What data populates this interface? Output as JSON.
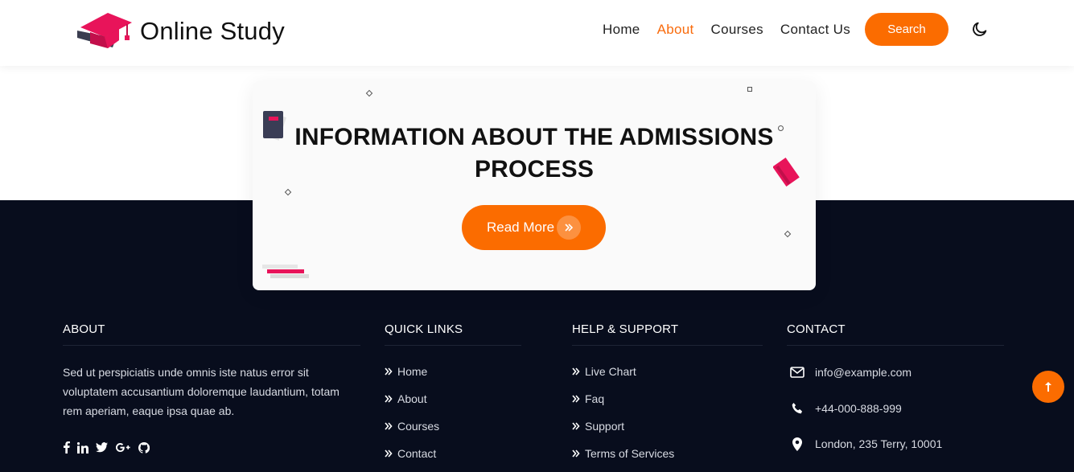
{
  "header": {
    "brand": "Online Study",
    "nav": [
      {
        "label": "Home",
        "active": false
      },
      {
        "label": "About",
        "active": true
      },
      {
        "label": "Courses",
        "active": false
      },
      {
        "label": "Contact Us",
        "active": false
      }
    ],
    "search_label": "Search",
    "theme_icon": "moon-icon"
  },
  "hero_card": {
    "title_line1": "INFORMATION ABOUT THE ADMISSIONS",
    "title_line2": "PROCESS",
    "button_label": "Read More"
  },
  "footer": {
    "about": {
      "heading": "ABOUT",
      "text_lines": [
        "Sed ut perspiciatis unde omnis iste natus error sit",
        "voluptatem accusantium doloremque laudantium, totam",
        "rem aperiam, eaque ipsa quae ab."
      ],
      "social_icons": [
        "facebook-icon",
        "linkedin-icon",
        "twitter-icon",
        "google-plus-icon",
        "github-icon"
      ]
    },
    "quick_links": {
      "heading": "QUICK LINKS",
      "items": [
        "Home",
        "About",
        "Courses",
        "Contact"
      ]
    },
    "help_support": {
      "heading": "HELP & SUPPORT",
      "items": [
        "Live Chart",
        "Faq",
        "Support",
        "Terms of Services"
      ]
    },
    "contact": {
      "heading": "CONTACT",
      "email": "info@example.com",
      "phone": "+44-000-888-999",
      "address": "London, 235 Terry, 10001"
    }
  },
  "colors": {
    "accent": "#fb6c00",
    "footer_bg": "#080d1d",
    "brand_pink": "#e8145a"
  }
}
